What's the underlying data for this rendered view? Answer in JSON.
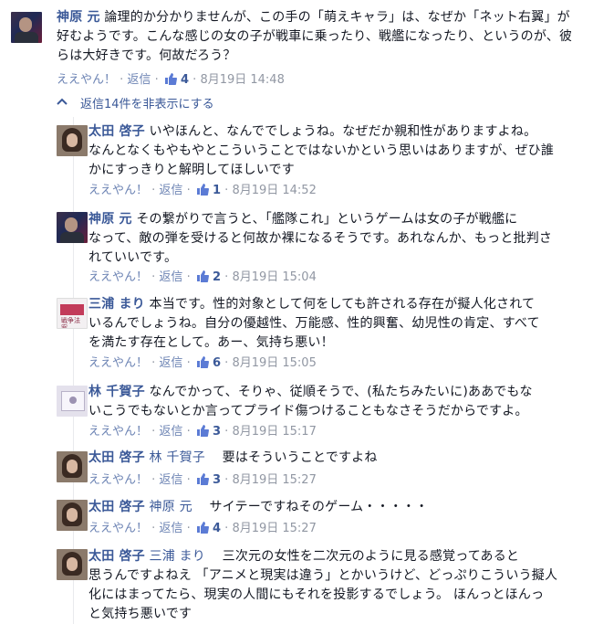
{
  "thread": {
    "top_comment": {
      "author": "神原 元",
      "lines": [
        "論理的か分かりませんが、この手の「萌えキャラ」は、なぜか「ネット右翼」が",
        "好むようです。こんな感じの女の子が戦車に乗ったり、戦艦になったり、というのが、彼",
        "らは大好きです。何故だろう？"
      ],
      "meta": {
        "like": "ええやん！",
        "reply": "返信",
        "like_count": "4",
        "time": "8月19日 14:48"
      }
    },
    "toggle_label": "返信14件を非表示にする",
    "replies": [
      {
        "author": "太田 啓子",
        "tagged": "",
        "lines": [
          "いやほんと、なんででしょうね。なぜだか親和性がありますよね。",
          "なんとなくもやもやとこういうことではないかという思いはありますが、ぜひ誰",
          "かにすっきりと解明してほしいです"
        ],
        "meta": {
          "like": "ええやん！",
          "reply": "返信",
          "like_count": "1",
          "time": "8月19日 14:52"
        }
      },
      {
        "author": "神原 元",
        "tagged": "",
        "lines": [
          "その繋がりで言うと、「艦隊これ」というゲームは女の子が戦艦に",
          "なって、敵の弾を受けると何故か裸になるそうです。あれなんか、もっと批判さ",
          "れていいです。"
        ],
        "meta": {
          "like": "ええやん！",
          "reply": "返信",
          "like_count": "2",
          "time": "8月19日 15:04"
        }
      },
      {
        "author": "三浦 まり",
        "tagged": "",
        "lines": [
          "本当です。性的対象として何をしても許される存在が擬人化されて",
          "いるんでしょうね。自分の優越性、万能感、性的興奮、幼児性の肯定、すべて",
          "を満たす存在として。あー、気持ち悪い！"
        ],
        "meta": {
          "like": "ええやん！",
          "reply": "返信",
          "like_count": "6",
          "time": "8月19日 15:05"
        }
      },
      {
        "author": "林 千賀子",
        "tagged": "",
        "lines": [
          "なんでかって、そりゃ、従順そうで、(私たちみたいに)ああでもな",
          "いこうでもないとか言ってプライド傷つけることもなさそうだからですよ。"
        ],
        "meta": {
          "like": "ええやん！",
          "reply": "返信",
          "like_count": "3",
          "time": "8月19日 15:17"
        }
      },
      {
        "author": "太田 啓子",
        "tagged": "林 千賀子",
        "lines": [
          "要はそういうことですよね"
        ],
        "meta": {
          "like": "ええやん！",
          "reply": "返信",
          "like_count": "3",
          "time": "8月19日 15:27"
        }
      },
      {
        "author": "太田 啓子",
        "tagged": "神原 元",
        "lines": [
          "サイテーですねそのゲーム・・・・・"
        ],
        "meta": {
          "like": "ええやん！",
          "reply": "返信",
          "like_count": "4",
          "time": "8月19日 15:27"
        }
      },
      {
        "author": "太田 啓子",
        "tagged": "三浦 まり",
        "lines": [
          "三次元の女性を二次元のように見る感覚ってあると",
          "思うんですよねえ 「アニメと現実は違う」とかいうけど、どっぷりこういう擬人",
          "化にはまってたら、現実の人間にもそれを投影するでしょう。 ほんっとほんっ",
          "と気持ち悪いです"
        ]
      }
    ]
  },
  "avatar_miura_text": "戦争法案",
  "colors": {
    "link": "#3b5998",
    "meta": "#9197a3",
    "text": "#141823"
  }
}
